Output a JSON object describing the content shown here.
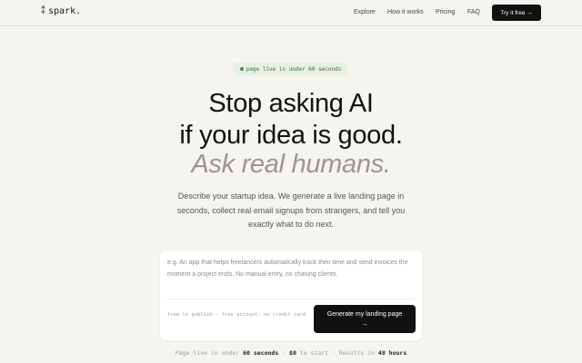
{
  "nav": {
    "logo_text": "spark.",
    "links": [
      "Explore",
      "How it works",
      "Pricing",
      "FAQ"
    ],
    "cta": "Try it free →"
  },
  "badge": {
    "text": "page live in under 60 seconds"
  },
  "hero": {
    "line1": "Stop asking AI",
    "line2": "if your idea is good.",
    "line3": "Ask real humans.",
    "sub": "Describe your startup idea. We generate a live landing page in seconds, collect real email signups from strangers, and tell you exactly what to do next."
  },
  "form": {
    "placeholder": "e.g. An app that helps freelancers automatically track their time and send invoices the moment a project ends. No manual entry, no chasing clients.",
    "note": "free to publish · free account, no credit card",
    "button_line1": "Generate my landing page",
    "button_line2": "→"
  },
  "stats": {
    "prefix": "Page live in under",
    "stat1": "60 seconds",
    "sep1": "·",
    "stat2": "$0",
    "mid": "to start",
    "sep2": "·",
    "suffix": "Results in",
    "stat3": "48 hours"
  },
  "colors": {
    "background": "#f6f4ee",
    "primary": "#111111",
    "badge_bg": "#e6f1e4",
    "badge_text": "#3b6a3f",
    "muted_headline": "#9a978e"
  }
}
